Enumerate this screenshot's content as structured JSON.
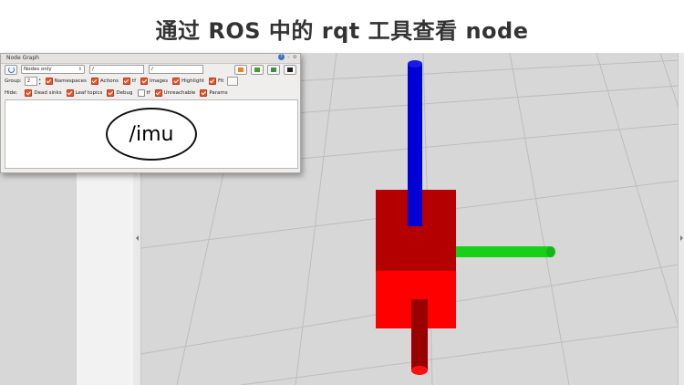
{
  "slide": {
    "title": "通过 ROS 中的 rqt 工具查看 node"
  },
  "rqt": {
    "window_title": "Node Graph",
    "title_buttons": "- o",
    "help_icon": "help-icon",
    "graph_mode": "Nodes only",
    "ns_filter": "/",
    "topic_filter": "/",
    "group_label": "Group:",
    "group_value": "2",
    "options": [
      {
        "label": "Namespaces",
        "checked": true
      },
      {
        "label": "Actions",
        "checked": true
      },
      {
        "label": "tf",
        "checked": true
      },
      {
        "label": "Images",
        "checked": true
      },
      {
        "label": "Highlight",
        "checked": true
      },
      {
        "label": "Fit",
        "checked": true
      }
    ],
    "hide_label": "Hide:",
    "hide_options": [
      {
        "label": "Dead sinks",
        "checked": true
      },
      {
        "label": "Leaf topics",
        "checked": true
      },
      {
        "label": "Debug",
        "checked": true
      },
      {
        "label": "tf",
        "checked": false
      },
      {
        "label": "Unreachable",
        "checked": true
      },
      {
        "label": "Params",
        "checked": true
      }
    ],
    "node_label": "/imu"
  },
  "colors": {
    "cube_red": "#e00000",
    "axis_x": "#00cc00",
    "axis_y": "#0000cc",
    "axis_z": "#cc0000",
    "grid_bg": "#d7d7d7",
    "checkbox_accent": "#e4572e"
  }
}
